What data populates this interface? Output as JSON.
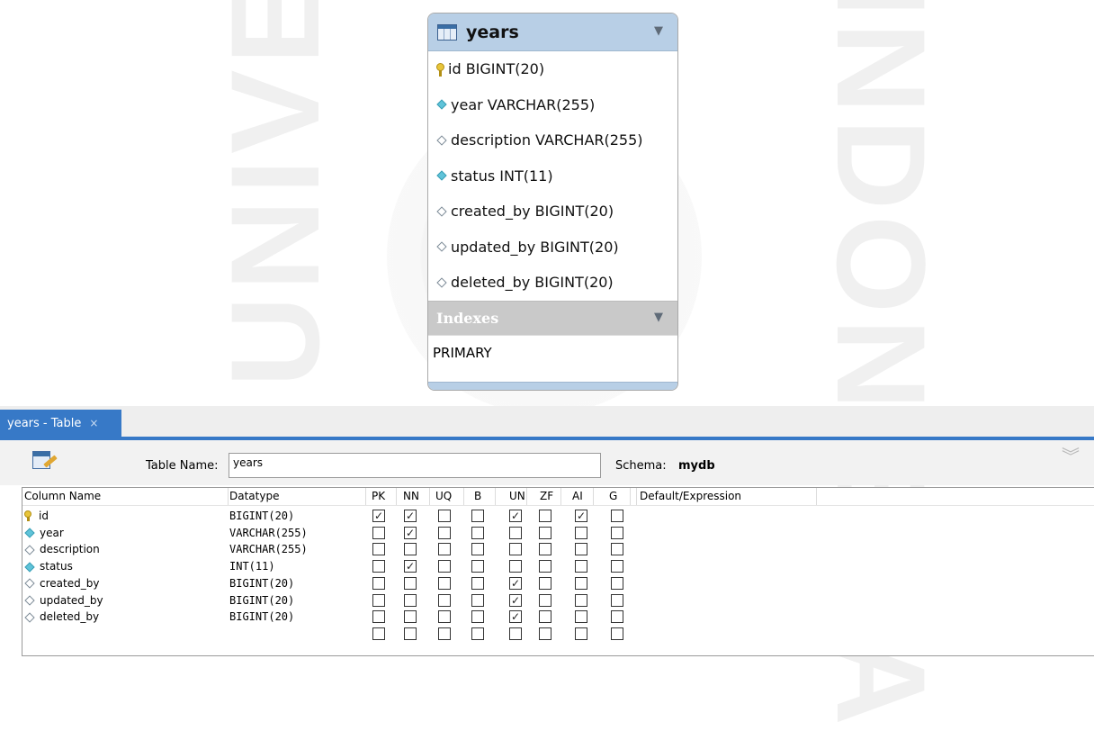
{
  "entity": {
    "title": "years",
    "columns": [
      {
        "name": "id BIGINT(20)",
        "icon": "primary-key-icon"
      },
      {
        "name": "year VARCHAR(255)",
        "icon": "not-null-column-icon"
      },
      {
        "name": "description VARCHAR(255)",
        "icon": "nullable-column-icon"
      },
      {
        "name": "status INT(11)",
        "icon": "not-null-column-icon"
      },
      {
        "name": "created_by BIGINT(20)",
        "icon": "nullable-column-icon"
      },
      {
        "name": "updated_by BIGINT(20)",
        "icon": "nullable-column-icon"
      },
      {
        "name": "deleted_by BIGINT(20)",
        "icon": "nullable-column-icon"
      }
    ],
    "indexes_title": "Indexes",
    "indexes": [
      "PRIMARY"
    ]
  },
  "tab": {
    "label": "years - Table",
    "close": "×"
  },
  "editor": {
    "table_name_label": "Table Name:",
    "table_name_value": "years",
    "schema_label": "Schema:",
    "schema_value": "mydb"
  },
  "grid": {
    "headers": [
      "Column Name",
      "Datatype",
      "PK",
      "NN",
      "UQ",
      "B",
      "UN",
      "ZF",
      "AI",
      "G",
      "Default/Expression"
    ],
    "rows": [
      {
        "name": "id",
        "icon": "primary-key-icon",
        "type": "BIGINT(20)",
        "flags": [
          1,
          1,
          0,
          0,
          1,
          0,
          1,
          0
        ]
      },
      {
        "name": "year",
        "icon": "not-null-column-icon",
        "type": "VARCHAR(255)",
        "flags": [
          0,
          1,
          0,
          0,
          0,
          0,
          0,
          0
        ]
      },
      {
        "name": "description",
        "icon": "nullable-column-icon",
        "type": "VARCHAR(255)",
        "flags": [
          0,
          0,
          0,
          0,
          0,
          0,
          0,
          0
        ]
      },
      {
        "name": "status",
        "icon": "not-null-column-icon",
        "type": "INT(11)",
        "flags": [
          0,
          1,
          0,
          0,
          0,
          0,
          0,
          0
        ]
      },
      {
        "name": "created_by",
        "icon": "nullable-column-icon",
        "type": "BIGINT(20)",
        "flags": [
          0,
          0,
          0,
          0,
          1,
          0,
          0,
          0
        ]
      },
      {
        "name": "updated_by",
        "icon": "nullable-column-icon",
        "type": "BIGINT(20)",
        "flags": [
          0,
          0,
          0,
          0,
          1,
          0,
          0,
          0
        ]
      },
      {
        "name": "deleted_by",
        "icon": "nullable-column-icon",
        "type": "BIGINT(20)",
        "flags": [
          0,
          0,
          0,
          0,
          1,
          0,
          0,
          0
        ]
      },
      {
        "name": "",
        "icon": "",
        "type": "",
        "flags": [
          0,
          0,
          0,
          0,
          0,
          0,
          0,
          0
        ]
      }
    ]
  },
  "watermark": {
    "left": "UNIVERSITAS",
    "right": "INDONESIA"
  }
}
